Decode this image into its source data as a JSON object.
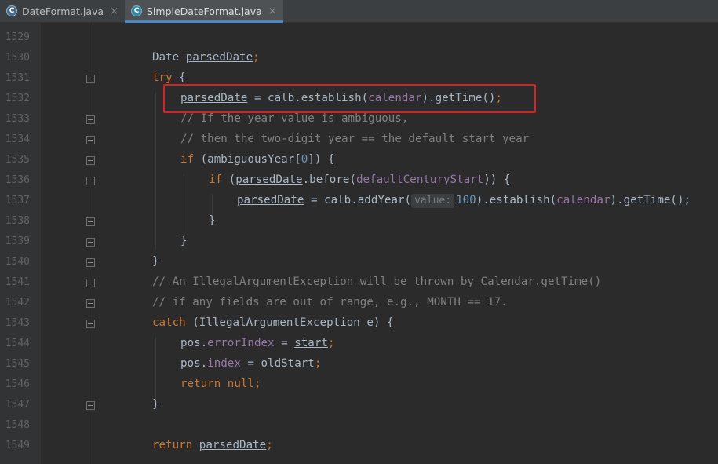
{
  "tabs": [
    {
      "name": "DateFormat.java",
      "active": false,
      "icon": "abstract-class-icon"
    },
    {
      "name": "SimpleDateFormat.java",
      "active": true,
      "icon": "class-icon"
    }
  ],
  "tab_close_glyph": "×",
  "tab_icon_letter": "C",
  "colors": {
    "keyword": "#cc7832",
    "field": "#9876aa",
    "number": "#6897bb",
    "comment": "#808080",
    "text": "#a9b7c6",
    "highlight_box": "#e02020",
    "tab_underline": "#4a88c7"
  },
  "editor": {
    "line_numbers": [
      "1529",
      "1530",
      "1531",
      "1532",
      "1533",
      "1534",
      "1535",
      "1536",
      "1537",
      "1538",
      "1539",
      "1540",
      "1541",
      "1542",
      "1543",
      "1544",
      "1545",
      "1546",
      "1547",
      "1548",
      "1549"
    ],
    "code": {
      "l1530_type": "Date",
      "l1530_var": "parsedDate",
      "l1531_kw": "try",
      "l1532_var": "parsedDate",
      "l1532_op": " = calb.establish(",
      "l1532_field": "calendar",
      "l1532_end": ").getTime()",
      "l1533": "// If the year value is ambiguous,",
      "l1534": "// then the two-digit year == the default start year",
      "l1535_kw": "if",
      "l1535_rest": " (ambiguousYear[",
      "l1535_num": "0",
      "l1535_end": "]) {",
      "l1536_kw": "if",
      "l1536_var": "parsedDate",
      "l1536_mid": ".before(",
      "l1536_field": "defaultCenturyStart",
      "l1536_end": ")) {",
      "l1537_var": "parsedDate",
      "l1537_mid": " = calb.addYear(",
      "l1537_hint": "value:",
      "l1537_num": "100",
      "l1537_mid2": ").establish(",
      "l1537_field": "calendar",
      "l1537_end": ").getTime();",
      "l1541": "// An IllegalArgumentException will be thrown by Calendar.getTime()",
      "l1542": "// if any fields are out of range, e.g., MONTH == 17.",
      "l1543_kw": "catch",
      "l1543_rest": " (IllegalArgumentException e) {",
      "l1544_obj": "pos.",
      "l1544_field": "errorIndex",
      "l1544_mid": " = ",
      "l1544_var": "start",
      "l1545_obj": "pos.",
      "l1545_field": "index",
      "l1545_rest": " = oldStart",
      "l1546_kw": "return null",
      "l1549_kw": "return",
      "l1549_var": "parsedDate"
    }
  }
}
